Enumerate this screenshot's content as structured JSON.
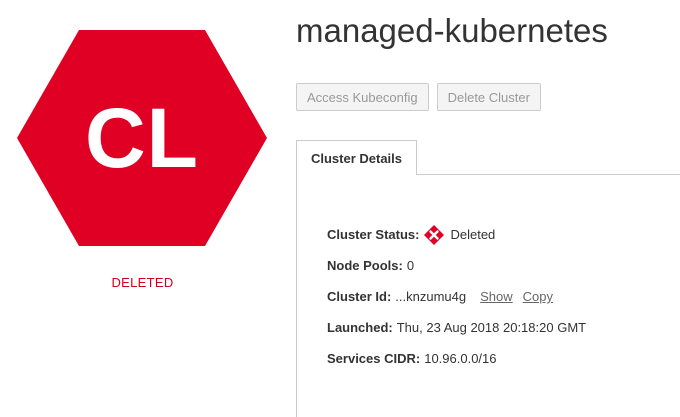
{
  "badge": {
    "initials": "CL",
    "color": "#e00024",
    "status_label": "DELETED",
    "status_color": "#d0021b"
  },
  "header": {
    "title": "managed-kubernetes"
  },
  "actions": {
    "access_kubeconfig_label": "Access Kubeconfig",
    "delete_cluster_label": "Delete Cluster"
  },
  "tabs": [
    {
      "label": "Cluster Details",
      "active": true
    }
  ],
  "details": {
    "cluster_status": {
      "label": "Cluster Status:",
      "value": "Deleted",
      "icon": "deleted-status-icon"
    },
    "node_pools": {
      "label": "Node Pools:",
      "value": "0"
    },
    "cluster_id": {
      "label": "Cluster Id:",
      "value": "...knzumu4g",
      "show_label": "Show",
      "copy_label": "Copy"
    },
    "launched": {
      "label": "Launched:",
      "value": "Thu, 23 Aug 2018 20:18:20 GMT"
    },
    "services_cidr": {
      "label": "Services CIDR:",
      "value": "10.96.0.0/16"
    }
  }
}
